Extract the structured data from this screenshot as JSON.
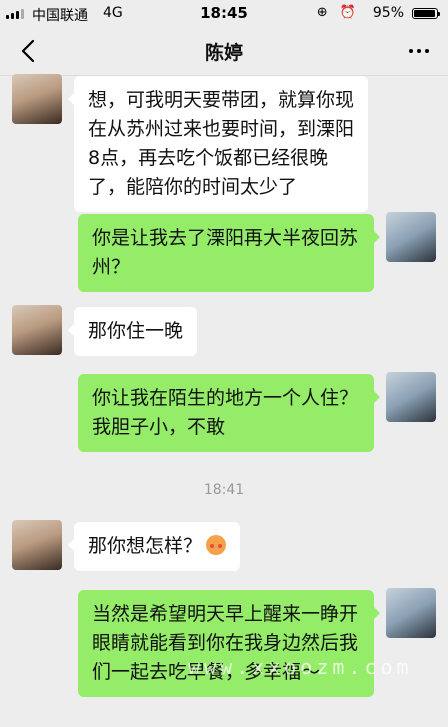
{
  "status_bar": {
    "carrier": "中国联通",
    "network": "4G",
    "time": "18:45",
    "icons": "⊕ ⏰",
    "battery_percent": "95%",
    "battery_level": 0.95
  },
  "navbar": {
    "title": "陈婷"
  },
  "messages": [
    {
      "side": "left",
      "text": "想，可我明天要带团，就算你现在从苏州过来也要时间，到溧阳8点，再去吃个饭都已经很晚了，能陪你的时间太少了"
    },
    {
      "side": "right",
      "text": "你是让我去了溧阳再大半夜回苏州？"
    },
    {
      "side": "left",
      "text": "那你住一晚"
    },
    {
      "side": "right",
      "text": "你让我在陌生的地方一个人住？我胆子小，不敢"
    },
    {
      "side": "left",
      "text": "那你想怎样？",
      "emoji": "flushed-face"
    },
    {
      "side": "right",
      "text": "当然是希望明天早上醒来一睁开眼睛就能看到你在我身边然后我们一起去吃早餐，多幸福～"
    }
  ],
  "timestamp": "18:41",
  "watermark": "www.xxoozm.com"
}
